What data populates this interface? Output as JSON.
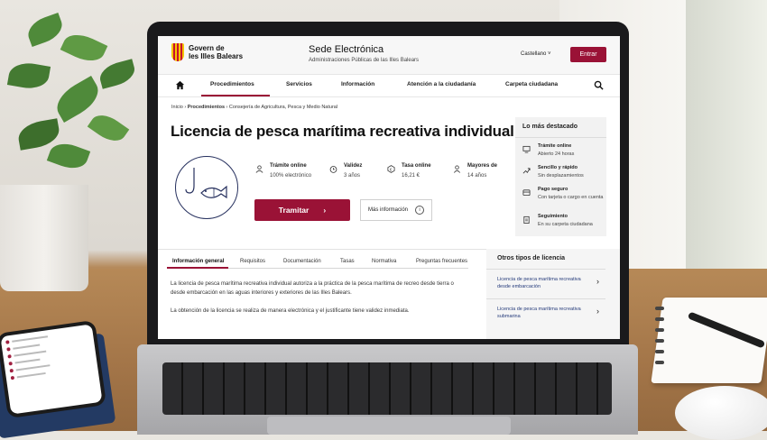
{
  "header": {
    "logo_line1": "Govern de",
    "logo_line2": "les Illes Balears",
    "site_title": "Sede Electrónica",
    "site_subtitle": "Administraciones Públicas de las Illes Balears",
    "language": "Castellano",
    "login_button": "Entrar"
  },
  "nav": {
    "items": [
      "Procedimientos",
      "Servicios",
      "Información",
      "Atención a la ciudadanía",
      "Carpeta ciudadana"
    ]
  },
  "breadcrumb": {
    "home": "Inicio",
    "level1": "Procedimientos",
    "level2": "Consejería de Agricultura, Pesca y Medio Natural"
  },
  "page": {
    "title": "Licencia de pesca marítima recreativa individual"
  },
  "facts": [
    {
      "label": "Trámite online",
      "value": "100% electrónico"
    },
    {
      "label": "Validez",
      "value": "3 años"
    },
    {
      "label": "Tasa online",
      "value": "16,21 €"
    },
    {
      "label": "Mayores de",
      "value": "14 años"
    }
  ],
  "actions": {
    "primary": "Tramitar",
    "secondary": "Más información"
  },
  "highlights": {
    "title": "Lo más destacado",
    "items": [
      {
        "label": "Trámite online",
        "value": "Abierto 24 horas"
      },
      {
        "label": "Sencillo y rápido",
        "value": "Sin desplazamientos"
      },
      {
        "label": "Pago seguro",
        "value": "Con tarjeta o cargo en cuenta"
      },
      {
        "label": "Seguimiento",
        "value": "En su carpeta ciudadana"
      }
    ]
  },
  "tabs": [
    "Información general",
    "Requisitos",
    "Documentación",
    "Tasas",
    "Normativa",
    "Preguntas frecuentes"
  ],
  "content": {
    "p1": "La licencia de pesca marítima recreativa individual autoriza a la práctica de la pesca marítima de recreo desde tierra o desde embarcación en las aguas interiores y exteriores de las Illes Balears.",
    "p2": "La obtención de la licencia se realiza de manera electrónica y el justificante tiene validez inmediata."
  },
  "other_licenses": {
    "title": "Otros tipos de licencia",
    "items": [
      "Licencia de pesca marítima recreativa desde embarcación",
      "Licencia de pesca marítima recreativa submarina"
    ]
  },
  "colors": {
    "brand": "#9a1236",
    "link": "#243a7a",
    "icon": "#26305e"
  }
}
